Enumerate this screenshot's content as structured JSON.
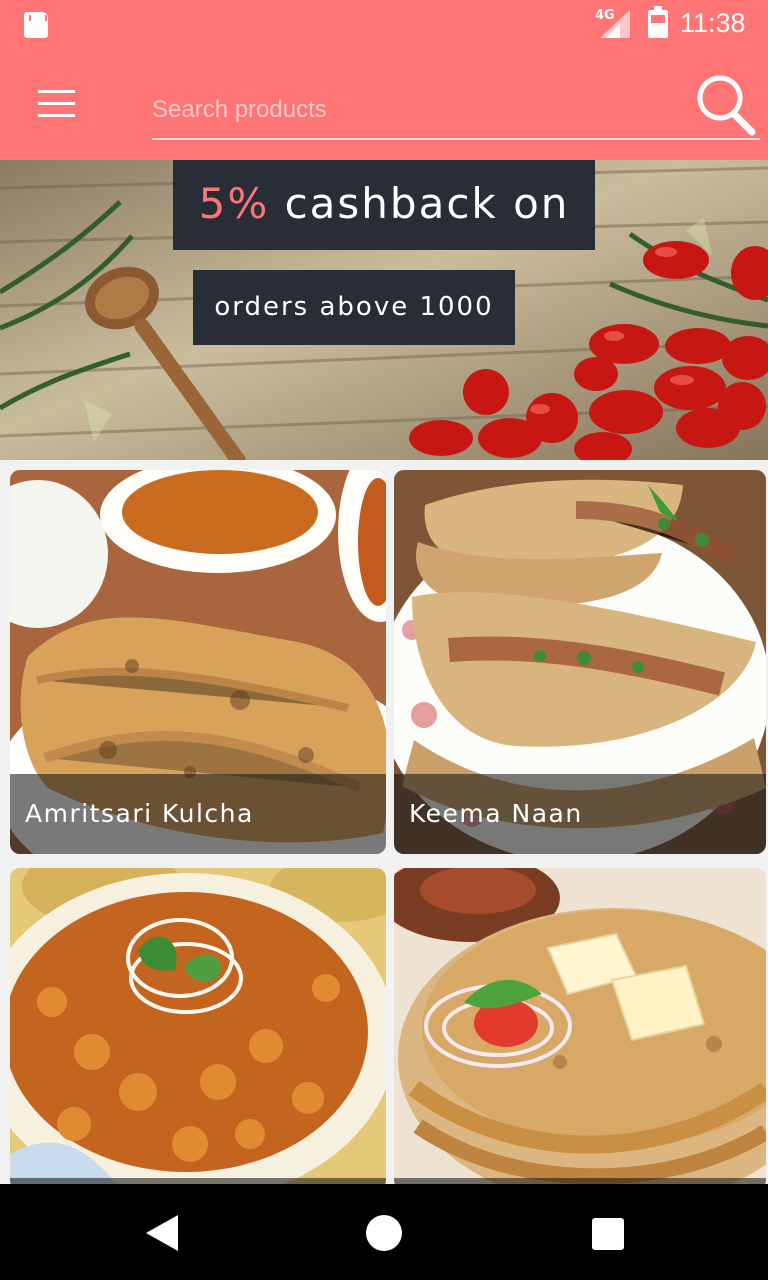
{
  "theme": {
    "accent": "#ff7474",
    "promo_background": "#282d38",
    "navigation_bar": "#000000"
  },
  "status_bar": {
    "network_label": "4G",
    "time": "11:38",
    "icons": [
      "sd-card-icon",
      "signal-icon",
      "battery-icon"
    ]
  },
  "app_bar": {
    "menu_icon": "menu-icon",
    "search_placeholder": "Search products",
    "search_value": "",
    "search_icon": "search-icon"
  },
  "banner": {
    "promo_accent": "5%",
    "promo_line_1_rest": " cashback on",
    "promo_line_2": "orders above 1000"
  },
  "products": [
    {
      "name": "Amritsari Kulcha"
    },
    {
      "name": "Keema Naan"
    },
    {
      "name": ""
    },
    {
      "name": ""
    }
  ],
  "system_nav": {
    "icons": [
      "back-icon",
      "home-icon",
      "recents-icon"
    ]
  }
}
